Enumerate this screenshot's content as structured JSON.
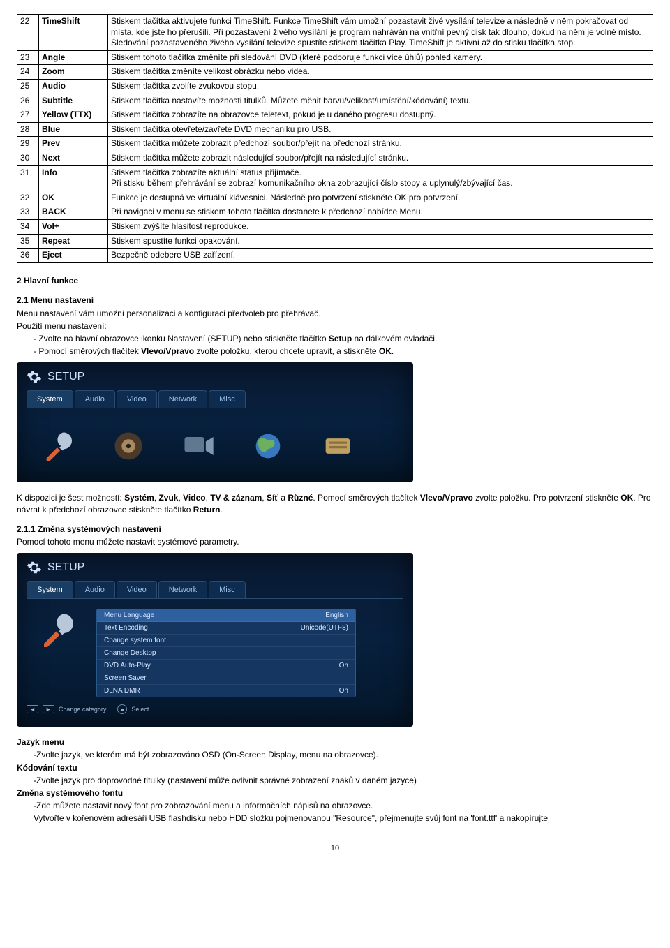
{
  "table": {
    "rows": [
      {
        "n": "22",
        "name": "TimeShift",
        "desc": "Stiskem tlačítka aktivujete funkci TimeShift. Funkce TimeShift vám umožní pozastavit živé vysílání televize a následně v něm pokračovat od místa, kde jste ho přerušili. Při pozastavení živého vysílání je program nahráván na vnitřní pevný disk tak dlouho, dokud na něm je volné místo. Sledování pozastaveného živého vysílání televize spustíte stiskem tlačítka Play. TimeShift je aktivní až do stisku tlačítka stop."
      },
      {
        "n": "23",
        "name": "Angle",
        "desc": "Stiskem tohoto tlačítka změníte při sledování DVD (které podporuje funkci více úhlů) pohled kamery."
      },
      {
        "n": "24",
        "name": "Zoom",
        "desc": "Stiskem tlačítka změníte velikost obrázku nebo videa."
      },
      {
        "n": "25",
        "name": "Audio",
        "desc": "Stiskem tlačítka zvolíte zvukovou stopu."
      },
      {
        "n": "26",
        "name": "Subtitle",
        "desc": "Stiskem tlačítka nastavíte možnosti titulků. Můžete měnit barvu/velikost/umístění/kódování) textu."
      },
      {
        "n": "27",
        "name": "Yellow (TTX)",
        "desc": "Stiskem tlačítka zobrazíte na obrazovce teletext, pokud je u daného progresu dostupný."
      },
      {
        "n": "28",
        "name": "Blue",
        "desc": "Stiskem tlačítka otevřete/zavřete DVD mechaniku pro USB."
      },
      {
        "n": "29",
        "name": "Prev",
        "desc": "Stiskem tlačítka můžete zobrazit předchozí soubor/přejít na předchozí stránku."
      },
      {
        "n": "30",
        "name": "Next",
        "desc": "Stiskem tlačítka můžete zobrazit následující soubor/přejít na následující stránku."
      },
      {
        "n": "31",
        "name": "Info",
        "desc": "Stiskem tlačítka zobrazíte aktuální status přijímače.\nPři stisku během přehrávání se zobrazí komunikačního okna zobrazující číslo stopy a uplynulý/zbývající čas."
      },
      {
        "n": "32",
        "name": "OK",
        "desc": "Funkce je dostupná ve virtuální klávesnici. Následně pro potvrzení stiskněte OK pro potvrzení."
      },
      {
        "n": "33",
        "name": "BACK",
        "desc": "Při navigaci v menu se stiskem tohoto tlačítka dostanete k předchozí nabídce Menu."
      },
      {
        "n": "34",
        "name": "Vol+",
        "desc": "Stiskem zvýšíte hlasitost reprodukce."
      },
      {
        "n": "35",
        "name": "Repeat",
        "desc": "Stiskem spustíte funkci opakování."
      },
      {
        "n": "36",
        "name": "Eject",
        "desc": "Bezpečně odebere USB zařízení."
      }
    ]
  },
  "sec2_title": "2   Hlavní funkce",
  "sec21_title": "2.1   Menu nastavení",
  "para1": "Menu nastavení vám umožní personalizaci a konfiguraci předvoleb pro přehrávač.",
  "para2": "Použití menu nastavení:",
  "bullet1_a": "-  Zvolte na hlavní obrazovce ikonku Nastavení (SETUP) nebo stiskněte tlačítko ",
  "bullet1_b": "Setup",
  "bullet1_c": " na dálkovém ovladači.",
  "bullet2_a": "-  Pomocí směrových tlačítek ",
  "bullet2_b": "Vlevo/Vpravo",
  "bullet2_c": " zvolte položku, kterou chcete upravit, a stiskněte ",
  "bullet2_d": "OK",
  "bullet2_e": ".",
  "setup1": {
    "title": "SETUP",
    "tabs": [
      "System",
      "Audio",
      "Video",
      "Network",
      "Misc"
    ]
  },
  "after_setup1_a": "K dispozici je šest možností: ",
  "after_setup1_b": "Systém",
  "after_setup1_c": ", ",
  "after_setup1_d": "Zvuk",
  "after_setup1_e": ", ",
  "after_setup1_f": "Video",
  "after_setup1_g": ", ",
  "after_setup1_h": "TV & záznam",
  "after_setup1_i": ", ",
  "after_setup1_j": "Síť",
  "after_setup1_k": " a ",
  "after_setup1_l": "Různé",
  "after_setup1_m": ". Pomocí směrových tlačítek ",
  "after_setup1_n": "Vlevo/Vpravo",
  "after_setup1_o": " zvolte položku. Pro potvrzení stiskněte ",
  "after_setup1_p": "OK",
  "after_setup1_q": ". Pro návrat k předchozí obrazovce stiskněte tlačítko ",
  "after_setup1_r": "Return",
  "after_setup1_s": ".",
  "sec211_title": "2.1.1 Změna systémových nastavení",
  "sec211_body": "Pomocí tohoto menu můžete nastavit systémové parametry.",
  "setup2": {
    "title": "SETUP",
    "tabs": [
      "System",
      "Audio",
      "Video",
      "Network",
      "Misc"
    ],
    "rows": [
      {
        "k": "Menu Language",
        "v": "English"
      },
      {
        "k": "Text Encoding",
        "v": "Unicode(UTF8)"
      },
      {
        "k": "Change system font",
        "v": ""
      },
      {
        "k": "Change Desktop",
        "v": ""
      },
      {
        "k": "DVD Auto-Play",
        "v": "On"
      },
      {
        "k": "Screen Saver",
        "v": ""
      },
      {
        "k": "DLNA DMR",
        "v": "On"
      }
    ],
    "hint1": "Change category",
    "hint2": "Select"
  },
  "lang_title": "Jazyk menu",
  "lang_body": "-Zvolte jazyk, ve kterém má být zobrazováno OSD (On-Screen Display, menu na obrazovce).",
  "enc_title": "Kódování textu",
  "enc_body": "-Zvolte jazyk pro doprovodné titulky (nastavení může ovlivnit správné zobrazení znaků v daném jazyce)",
  "font_title": "Změna systémového fontu",
  "font_body1": "-Zde můžete nastavit nový font pro zobrazování menu a informačních nápisů na obrazovce.",
  "font_body2": "Vytvořte v kořenovém adresáři USB flashdisku nebo HDD složku pojmenovanou \"Resource\", přejmenujte svůj font na 'font.ttf' a nakopírujte",
  "pagenum": "10"
}
